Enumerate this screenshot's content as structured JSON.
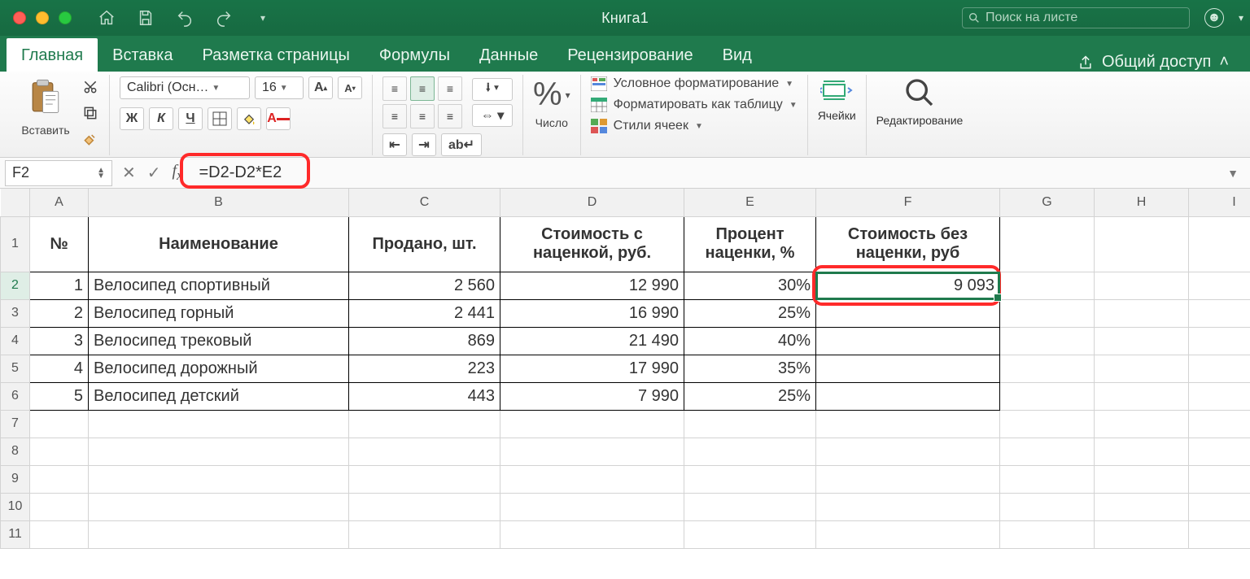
{
  "window": {
    "title": "Книга1"
  },
  "search": {
    "placeholder": "Поиск на листе"
  },
  "tabs": {
    "items": [
      "Главная",
      "Вставка",
      "Разметка страницы",
      "Формулы",
      "Данные",
      "Рецензирование",
      "Вид"
    ],
    "active": 0,
    "share": "Общий доступ"
  },
  "ribbon": {
    "paste": "Вставить",
    "font_name": "Calibri (Осн…",
    "font_size": "16",
    "bold": "Ж",
    "italic": "К",
    "underline": "Ч",
    "inc_font": "A",
    "dec_font": "A",
    "number_group": "Число",
    "cond_fmt": "Условное форматирование",
    "fmt_table": "Форматировать как таблицу",
    "cell_styles": "Стили ячеек",
    "cells": "Ячейки",
    "editing": "Редактирование"
  },
  "formula_bar": {
    "name_box": "F2",
    "formula": "=D2-D2*E2"
  },
  "columns": [
    "A",
    "B",
    "C",
    "D",
    "E",
    "F",
    "G",
    "H",
    "I"
  ],
  "headers": {
    "A": "№",
    "B": "Наименование",
    "C": "Продано, шт.",
    "D": "Стоимость с наценкой, руб.",
    "E": "Процент наценки, %",
    "F": "Стоимость без наценки, руб"
  },
  "rows": [
    {
      "n": "1",
      "name": "Велосипед спортивный",
      "sold": "2 560",
      "price": "12 990",
      "pct": "30%",
      "net": "9 093"
    },
    {
      "n": "2",
      "name": "Велосипед горный",
      "sold": "2 441",
      "price": "16 990",
      "pct": "25%",
      "net": ""
    },
    {
      "n": "3",
      "name": "Велосипед трековый",
      "sold": "869",
      "price": "21 490",
      "pct": "40%",
      "net": ""
    },
    {
      "n": "4",
      "name": "Велосипед дорожный",
      "sold": "223",
      "price": "17 990",
      "pct": "35%",
      "net": ""
    },
    {
      "n": "5",
      "name": "Велосипед детский",
      "sold": "443",
      "price": "7 990",
      "pct": "25%",
      "net": ""
    }
  ],
  "selected_cell": "F2",
  "chart_data": {
    "type": "table",
    "title": "Книга1",
    "columns": [
      "№",
      "Наименование",
      "Продано, шт.",
      "Стоимость с наценкой, руб.",
      "Процент наценки, %",
      "Стоимость без наценки, руб"
    ],
    "data": [
      [
        1,
        "Велосипед спортивный",
        2560,
        12990,
        0.3,
        9093
      ],
      [
        2,
        "Велосипед горный",
        2441,
        16990,
        0.25,
        null
      ],
      [
        3,
        "Велосипед трековый",
        869,
        21490,
        0.4,
        null
      ],
      [
        4,
        "Велосипед дорожный",
        223,
        17990,
        0.35,
        null
      ],
      [
        5,
        "Велосипед детский",
        443,
        7990,
        0.25,
        null
      ]
    ]
  }
}
